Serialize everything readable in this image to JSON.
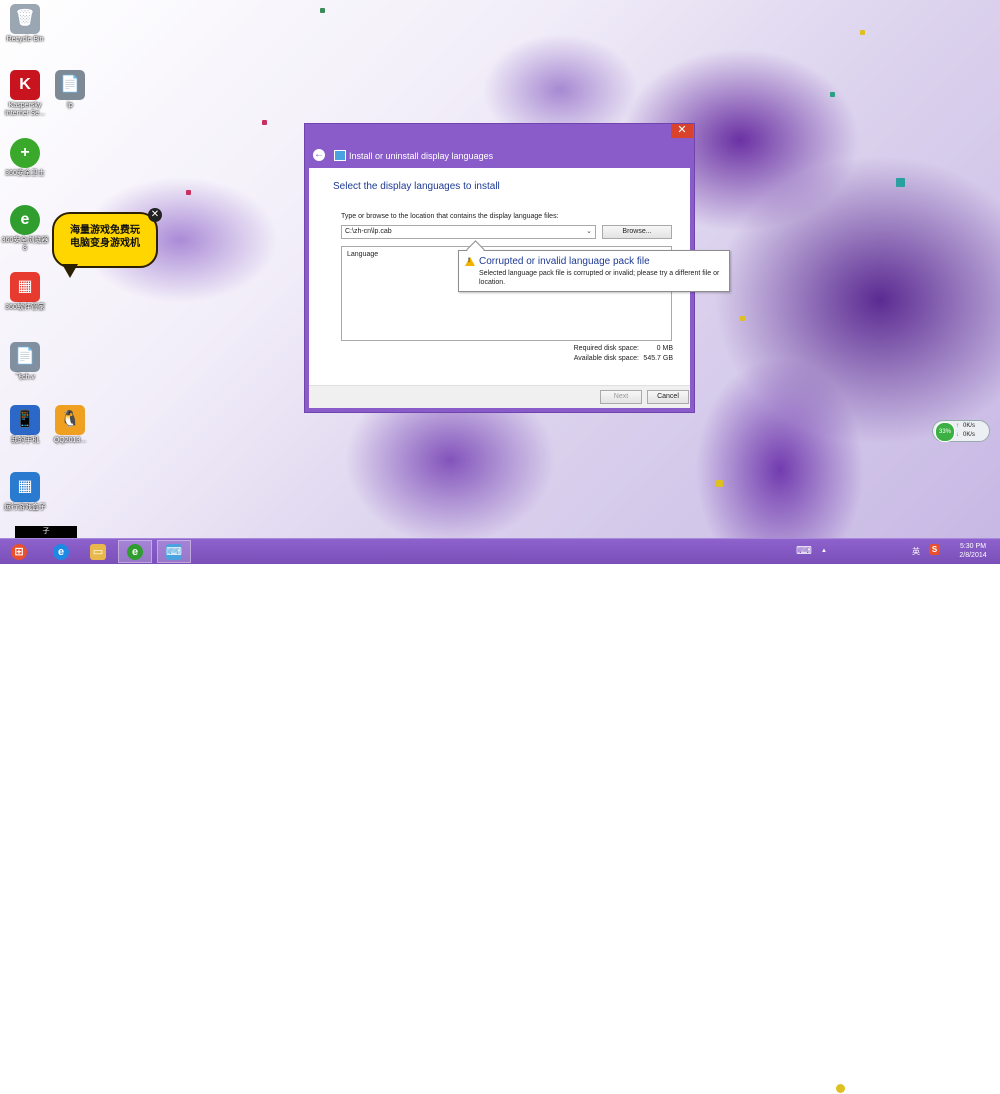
{
  "desktop": {
    "icons": [
      {
        "label": "Recycle Bin",
        "glyph": "🗑",
        "color": "#9aa6b2"
      },
      {
        "label": "Kaspersky Internet Se...",
        "glyph": "K",
        "color": "#c8141e"
      },
      {
        "label": "lp",
        "glyph": "📄",
        "color": "#7d8a96"
      },
      {
        "label": "360安全卫士",
        "glyph": "+",
        "color": "#3aa82a"
      },
      {
        "label": "360安全浏览器8",
        "glyph": "e",
        "color": "#2f9e2f"
      },
      {
        "label": "360软件管家",
        "glyph": "▦",
        "color": "#e63b2e"
      },
      {
        "label": "飞ch.v",
        "glyph": "📄",
        "color": "#8090a0"
      },
      {
        "label": "我的手机",
        "glyph": "📱",
        "color": "#2c68c8"
      },
      {
        "label": "QQ2013...",
        "glyph": "🐧",
        "color": "#f0a020"
      },
      {
        "label": "运行游戏盒子",
        "glyph": "▦",
        "color": "#2a7ad0"
      }
    ],
    "ad_bubble": {
      "line1": "海量游戏免费玩",
      "line2": "电脑变身游戏机",
      "close": "✕"
    },
    "black_bar_text": "子"
  },
  "dialog": {
    "close_glyph": "✕",
    "back_glyph": "←",
    "title": "Install or uninstall display languages",
    "heading": "Select the display languages to install",
    "prompt": "Type or browse to the location that contains the display language files:",
    "path_value": "C:\\zh-cn\\lp.cab",
    "combo_arrow": "⌄",
    "browse_label": "Browse...",
    "list_header": "Language",
    "required_label": "Required disk space:",
    "required_value": "0 MB",
    "available_label": "Available disk space:",
    "available_value": "545.7 GB",
    "next_label": "Next",
    "cancel_label": "Cancel"
  },
  "tooltip": {
    "title": "Corrupted or invalid language pack file",
    "message": "Selected language pack file is corrupted or invalid; please try a different file or location.",
    "warn_mark": "!"
  },
  "net_widget": {
    "percent": "33%",
    "up": "0K/s",
    "down": "0K/s",
    "up_arrow": "↑",
    "down_arrow": "↓"
  },
  "taskbar": {
    "start_glyph": "⊞",
    "apps": [
      {
        "name": "internet-explorer",
        "glyph": "e",
        "color": "#1e88e5"
      },
      {
        "name": "file-explorer",
        "glyph": "▭",
        "color": "#e8b84a"
      },
      {
        "name": "360-browser",
        "glyph": "e",
        "color": "#2f9e2f"
      },
      {
        "name": "language-installer",
        "glyph": "⌨",
        "color": "#4aa3df"
      }
    ],
    "tray": {
      "keyboard": "⌨",
      "chevron": "▲",
      "ime": "英",
      "sogou": "S",
      "clock_time": "5:30 PM",
      "clock_date": "2/8/2014"
    }
  },
  "colors": {
    "accent": "#8a5cc9",
    "link_blue": "#1f3a93",
    "close_red": "#d9432c",
    "warn_yellow": "#f0b400"
  }
}
